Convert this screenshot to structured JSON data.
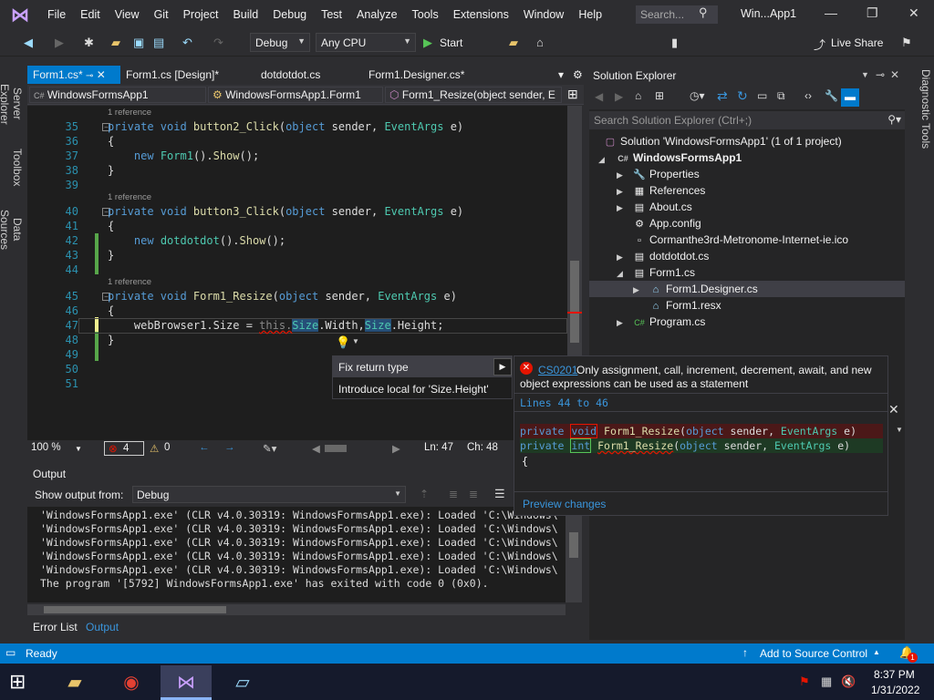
{
  "titlebar": {
    "menu": [
      "File",
      "Edit",
      "View",
      "Git",
      "Project",
      "Build",
      "Debug",
      "Test",
      "Analyze",
      "Tools",
      "Extensions",
      "Window",
      "Help"
    ],
    "search_placeholder": "Search...",
    "window_title": "Win...App1"
  },
  "toolbar": {
    "config": "Debug",
    "platform": "Any CPU",
    "start_label": "Start",
    "live_share": "Live Share"
  },
  "left_tabs": [
    "Server Explorer",
    "Toolbox",
    "Data Sources"
  ],
  "right_tabs": [
    "Diagnostic Tools"
  ],
  "doc_tabs": [
    "Form1.cs*",
    "Form1.cs [Design]*",
    "dotdotdot.cs",
    "Form1.Designer.cs*"
  ],
  "navbar": {
    "project": "WindowsFormsApp1",
    "class": "WindowsFormsApp1.Form1",
    "member": "Form1_Resize(object sender, E"
  },
  "code": {
    "ref_label": "1 reference",
    "lines": [
      {
        "n": "35",
        "t": "private void button2_Click(object sender, EventArgs e)"
      },
      {
        "n": "36",
        "t": "{"
      },
      {
        "n": "37",
        "t": "    new Form1().Show();"
      },
      {
        "n": "38",
        "t": "}"
      },
      {
        "n": "39",
        "t": ""
      },
      {
        "n": "40",
        "t": "private void button3_Click(object sender, EventArgs e)"
      },
      {
        "n": "41",
        "t": "{"
      },
      {
        "n": "42",
        "t": "    new dotdotdot().Show();"
      },
      {
        "n": "43",
        "t": "}"
      },
      {
        "n": "44",
        "t": ""
      },
      {
        "n": "45",
        "t": "private void Form1_Resize(object sender, EventArgs e)"
      },
      {
        "n": "46",
        "t": "{"
      },
      {
        "n": "47",
        "t": "    webBrowser1.Size = this.Size.Width,Size.Height;"
      },
      {
        "n": "48",
        "t": "}"
      },
      {
        "n": "49",
        "t": ""
      },
      {
        "n": "50",
        "t": ""
      },
      {
        "n": "51",
        "t": ""
      }
    ]
  },
  "editor_status": {
    "zoom": "100 %",
    "errors": "4",
    "warnings": "0",
    "line": "Ln: 47",
    "col": "Ch: 48"
  },
  "quick_actions": {
    "items": [
      "Fix return type",
      "Introduce local for 'Size.Height'"
    ],
    "error_code": "CS0201",
    "error_message": "Only assignment, call, increment, decrement, await, and new object expressions can be used as a statement",
    "lines_range": "Lines 44 to 46",
    "diff_old": "private void Form1_Resize(object sender, EventArgs e)",
    "diff_new": "private int Form1_Resize(object sender, EventArgs e)",
    "diff_brace": "{",
    "preview_link": "Preview changes"
  },
  "output": {
    "title": "Output",
    "show_from_label": "Show output from:",
    "source": "Debug",
    "lines": [
      "'WindowsFormsApp1.exe' (CLR v4.0.30319: WindowsFormsApp1.exe): Loaded 'C:\\Windows\\",
      "'WindowsFormsApp1.exe' (CLR v4.0.30319: WindowsFormsApp1.exe): Loaded 'C:\\Windows\\",
      "'WindowsFormsApp1.exe' (CLR v4.0.30319: WindowsFormsApp1.exe): Loaded 'C:\\Windows\\",
      "'WindowsFormsApp1.exe' (CLR v4.0.30319: WindowsFormsApp1.exe): Loaded 'C:\\Windows\\",
      "'WindowsFormsApp1.exe' (CLR v4.0.30319: WindowsFormsApp1.exe): Loaded 'C:\\Windows\\",
      "The program '[5792] WindowsFormsApp1.exe' has exited with code 0 (0x0)."
    ],
    "bottom_tabs": [
      "Error List",
      "Output"
    ]
  },
  "solution_explorer": {
    "title": "Solution Explorer",
    "search_placeholder": "Search Solution Explorer (Ctrl+;)",
    "solution": "Solution 'WindowsFormsApp1' (1 of 1 project)",
    "project": "WindowsFormsApp1",
    "items": [
      "Properties",
      "References",
      "About.cs",
      "App.config",
      "Cormanthe3rd-Metronome-Internet-ie.ico",
      "dotdotdot.cs",
      "Form1.cs",
      "Form1.Designer.cs",
      "Form1.resx",
      "Program.cs"
    ]
  },
  "statusbar": {
    "ready": "Ready",
    "source_control": "Add to Source Control",
    "notifications": "1"
  },
  "taskbar": {
    "time": "8:37 PM",
    "date": "1/31/2022"
  },
  "colors": {
    "accent": "#007acc",
    "editor_bg": "#1e1e1e",
    "error_red": "#e51400"
  }
}
